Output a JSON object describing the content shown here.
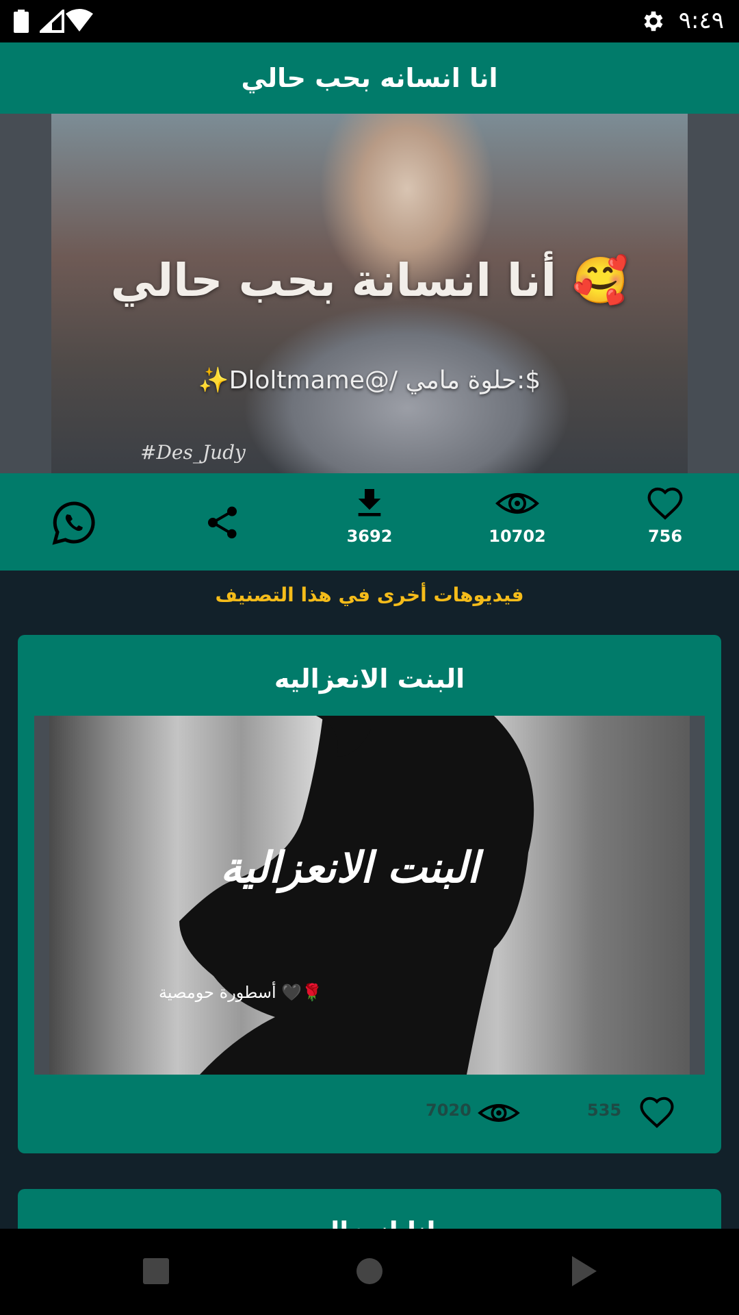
{
  "status_bar": {
    "time": "٩:٤٩",
    "icons": [
      "battery-icon",
      "signal-icon",
      "wifi-icon",
      "gear-icon"
    ]
  },
  "toolbar": {
    "title": "انا انسانه بحب حالي"
  },
  "video": {
    "overlay_title": "أنا انسانة بحب حالي 🥰",
    "overlay_credit": "✨Dloltmame@/ حلوة مامي:$",
    "overlay_tag": "#Des_Judy"
  },
  "actions": {
    "likes": "756",
    "views": "10702",
    "downloads": "3692",
    "share_icon": "share-icon",
    "whatsapp_icon": "whatsapp-icon"
  },
  "section": {
    "heading": "فيديوهات أخرى في هذا التصنيف"
  },
  "cards": [
    {
      "title": "البنت الانعزاليه",
      "thumb_title": "البنت الانعزالية",
      "thumb_sub": "أسطورة حومصية 🖤🌹",
      "likes": "535",
      "views": "7020"
    },
    {
      "title": "انا انعزاليه"
    }
  ],
  "colors": {
    "primary": "#017b6a",
    "background": "#12212a",
    "accent": "#f5bc1a"
  }
}
